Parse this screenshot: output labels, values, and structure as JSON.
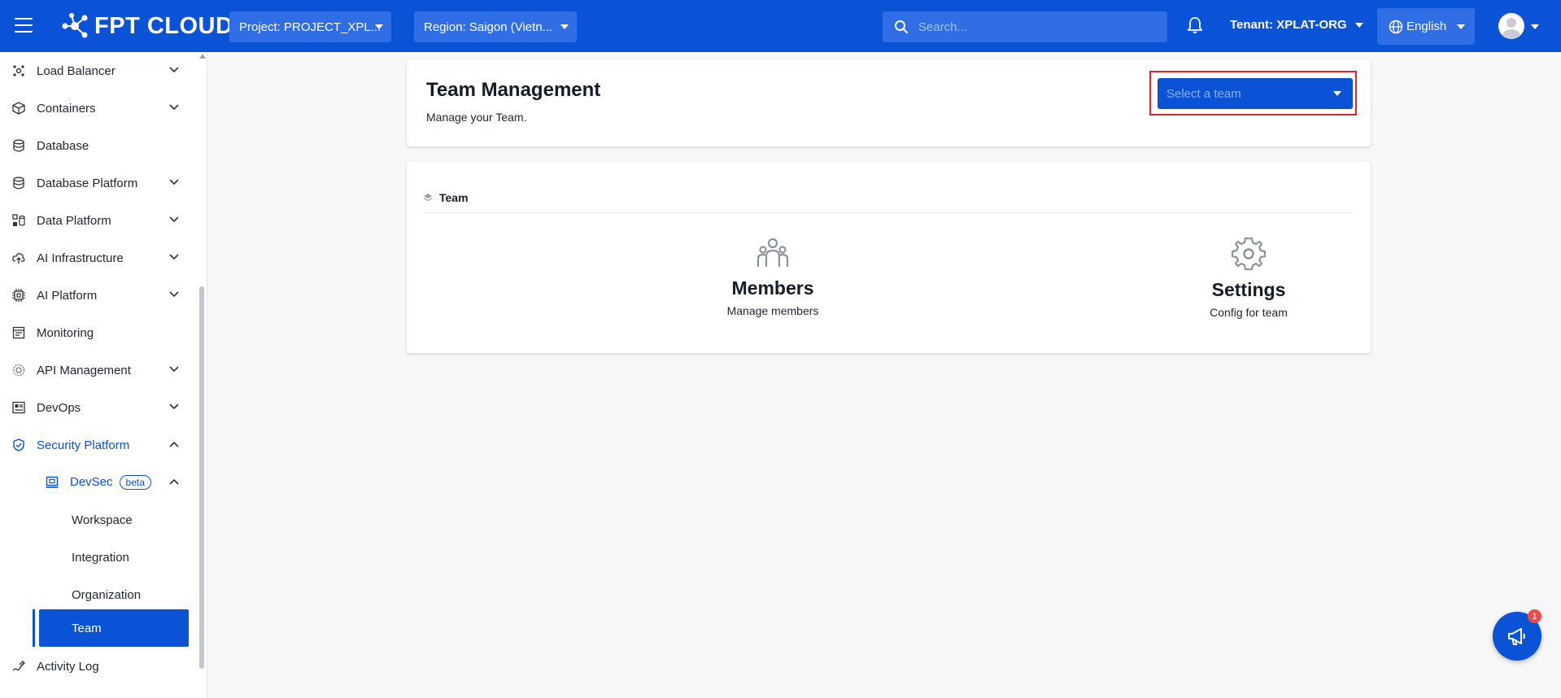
{
  "header": {
    "logo_text": "FPT CLOUD",
    "project_label": "Project: PROJECT_XPL...",
    "region_label": "Region: Saigon (Vietn...",
    "search_placeholder": "Search...",
    "tenant_label": "Tenant: XPLAT-ORG",
    "language_label": "English"
  },
  "sidebar": {
    "items": [
      {
        "label": "Load Balancer",
        "icon": "load-balancer-icon",
        "expandable": true
      },
      {
        "label": "Containers",
        "icon": "container-icon",
        "expandable": true
      },
      {
        "label": "Database",
        "icon": "database-icon",
        "expandable": false
      },
      {
        "label": "Database Platform",
        "icon": "database-platform-icon",
        "expandable": true
      },
      {
        "label": "Data Platform",
        "icon": "data-platform-icon",
        "expandable": true
      },
      {
        "label": "AI Infrastructure",
        "icon": "cloud-upload-icon",
        "expandable": true
      },
      {
        "label": "AI Platform",
        "icon": "chip-icon",
        "expandable": true
      },
      {
        "label": "Monitoring",
        "icon": "monitor-icon",
        "expandable": false
      },
      {
        "label": "API Management",
        "icon": "api-icon",
        "expandable": true
      },
      {
        "label": "DevOps",
        "icon": "devops-icon",
        "expandable": true
      },
      {
        "label": "Security Platform",
        "icon": "shield-icon",
        "expandable": true,
        "expanded": true
      }
    ],
    "devsec": {
      "label": "DevSec",
      "badge": "beta"
    },
    "devsec_children": [
      "Workspace",
      "Integration",
      "Organization",
      "Team"
    ],
    "selected": "Team",
    "activity_log": "Activity Log"
  },
  "main": {
    "title": "Team Management",
    "subtitle": "Manage your Team.",
    "team_select_placeholder": "Select a team",
    "section_title": "Team",
    "tiles": [
      {
        "title": "Members",
        "description": "Manage members",
        "icon": "members-icon"
      },
      {
        "title": "Settings",
        "description": "Config for team",
        "icon": "gear-icon"
      }
    ]
  },
  "fab": {
    "badge_count": "1",
    "icon": "megaphone-icon"
  },
  "colors": {
    "brand": "#0a52d6",
    "highlight_border": "#e0242c",
    "badge": "#f04a4a"
  }
}
